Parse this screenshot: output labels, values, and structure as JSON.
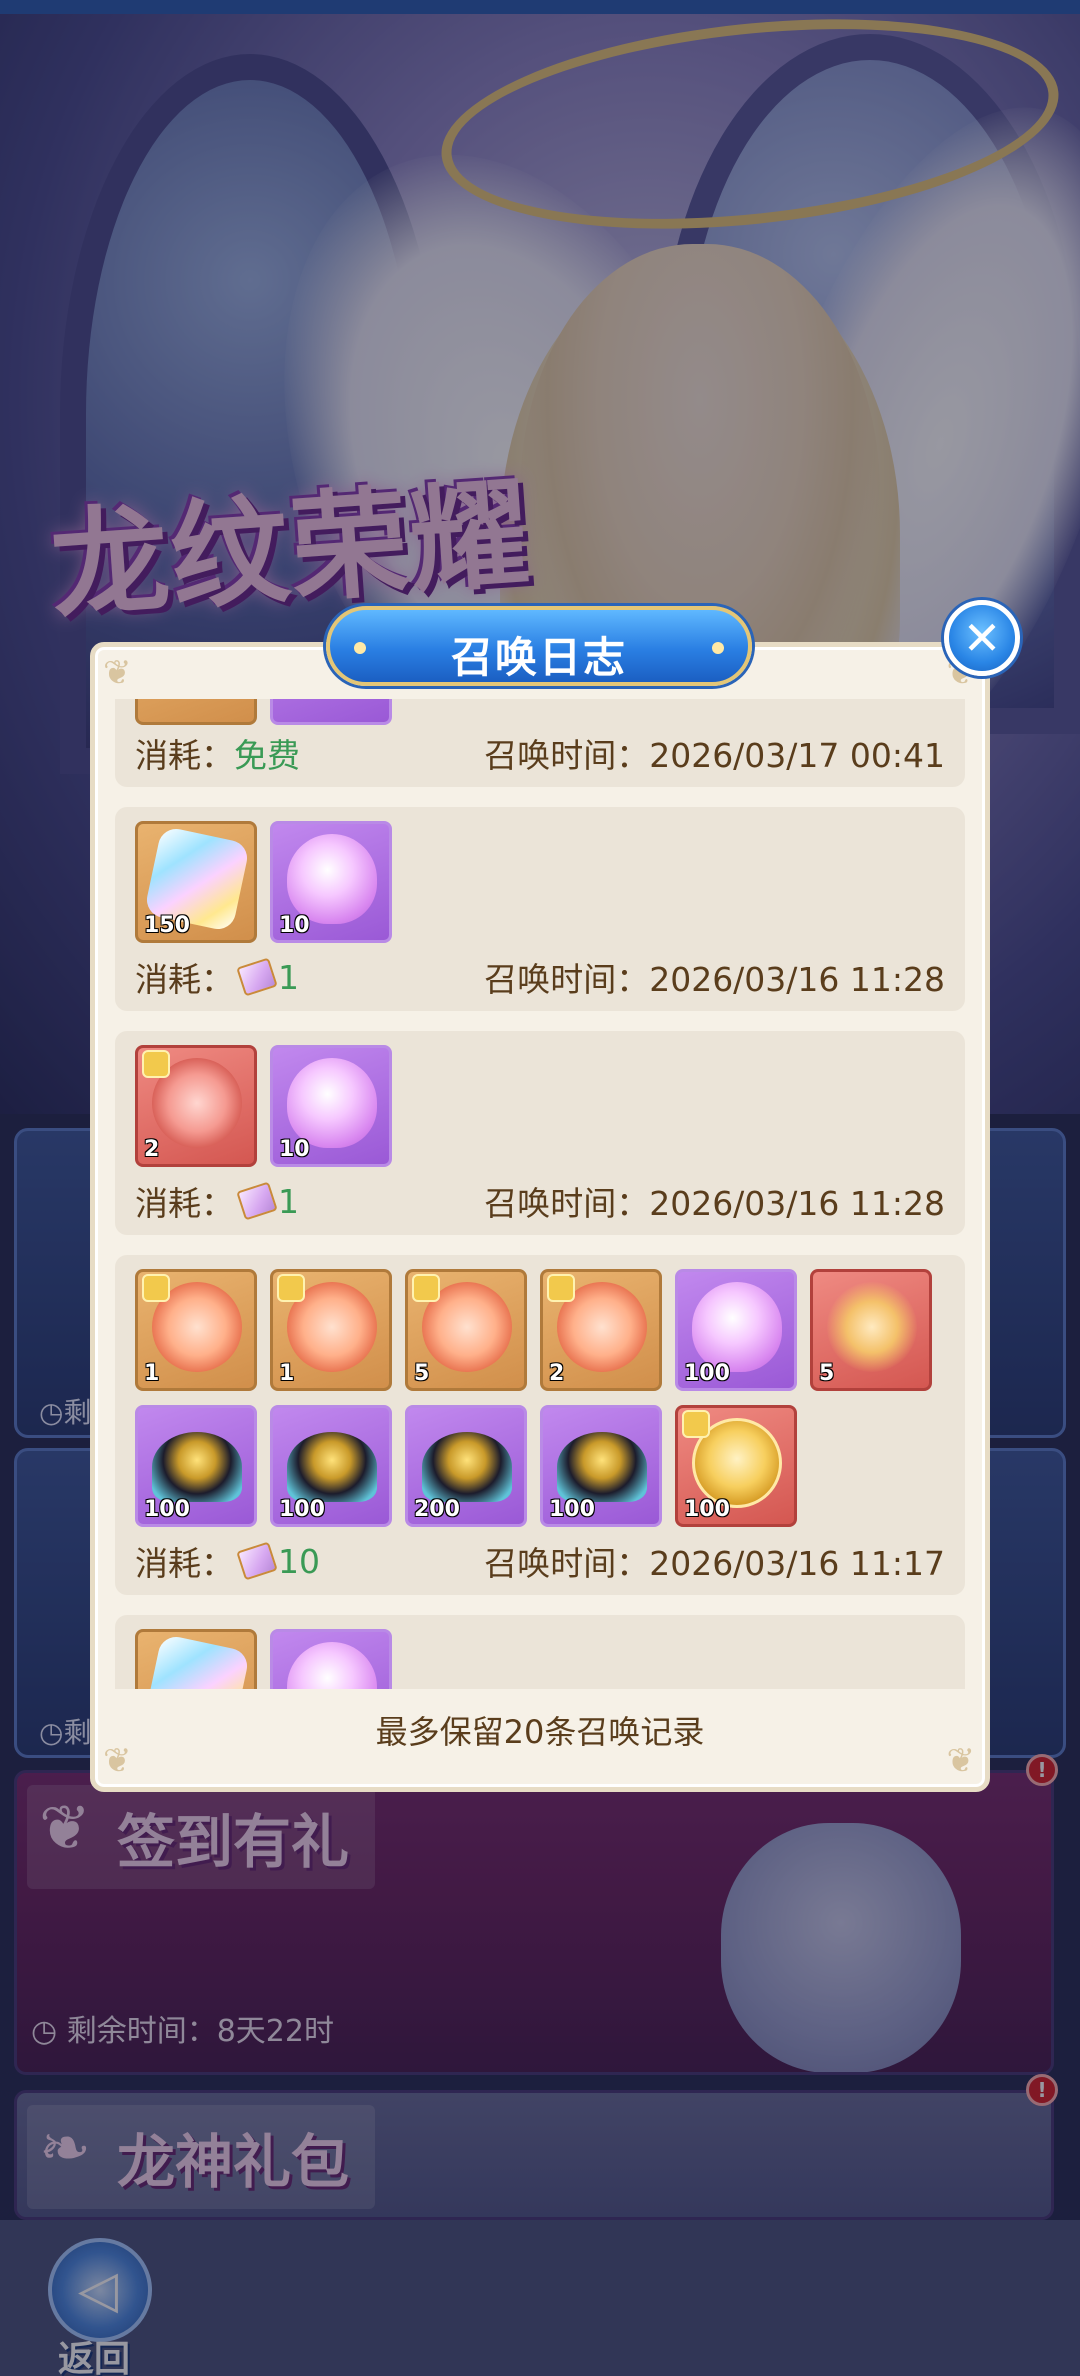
{
  "background": {
    "event_logo": "龙纹荣耀",
    "banners": [
      {
        "title": "签到有礼",
        "timer": "剩余时间：8天22时",
        "badge": "!"
      },
      {
        "title": "龙神礼包",
        "badge": "!"
      }
    ],
    "side_card_timer_glyph": "剩",
    "back_label": "返回"
  },
  "modal": {
    "title": "召唤日志",
    "close_symbol": "✕",
    "cost_label": "消耗：",
    "time_label": "召唤时间：",
    "footer": "最多保留20条召唤记录",
    "entries": [
      {
        "items": [],
        "cost": "免费",
        "time": "2026/03/17 00:41"
      },
      {
        "items": [
          {
            "kind": "crystal",
            "frame": "gold",
            "qty": "150"
          },
          {
            "kind": "heart",
            "frame": "purple",
            "qty": "10"
          }
        ],
        "cost": "1",
        "time": "2026/03/16 11:28"
      },
      {
        "items": [
          {
            "kind": "token-red",
            "frame": "red",
            "qty": "2",
            "puzzle": true
          },
          {
            "kind": "heart",
            "frame": "purple",
            "qty": "10"
          }
        ],
        "cost": "1",
        "time": "2026/03/16 11:28"
      },
      {
        "items": [
          {
            "kind": "token",
            "frame": "gold",
            "qty": "1",
            "puzzle": true
          },
          {
            "kind": "token",
            "frame": "gold",
            "qty": "1",
            "puzzle": true
          },
          {
            "kind": "token",
            "frame": "gold",
            "qty": "5",
            "puzzle": true
          },
          {
            "kind": "token",
            "frame": "gold",
            "qty": "2",
            "puzzle": true
          },
          {
            "kind": "heart",
            "frame": "purple",
            "qty": "100"
          },
          {
            "kind": "dragon",
            "frame": "red",
            "qty": "5"
          },
          {
            "kind": "ore",
            "frame": "purple",
            "qty": "100"
          },
          {
            "kind": "ore",
            "frame": "purple",
            "qty": "100"
          },
          {
            "kind": "ore",
            "frame": "purple",
            "qty": "200"
          },
          {
            "kind": "ore",
            "frame": "purple",
            "qty": "100"
          },
          {
            "kind": "goldcoin",
            "frame": "red",
            "qty": "100",
            "puzzle": true
          }
        ],
        "cost": "10",
        "time": "2026/03/16 11:17"
      },
      {
        "items": [
          {
            "kind": "crystal",
            "frame": "gold",
            "qty": ""
          },
          {
            "kind": "heart",
            "frame": "purple",
            "qty": ""
          }
        ],
        "cost": "",
        "time": ""
      }
    ]
  }
}
